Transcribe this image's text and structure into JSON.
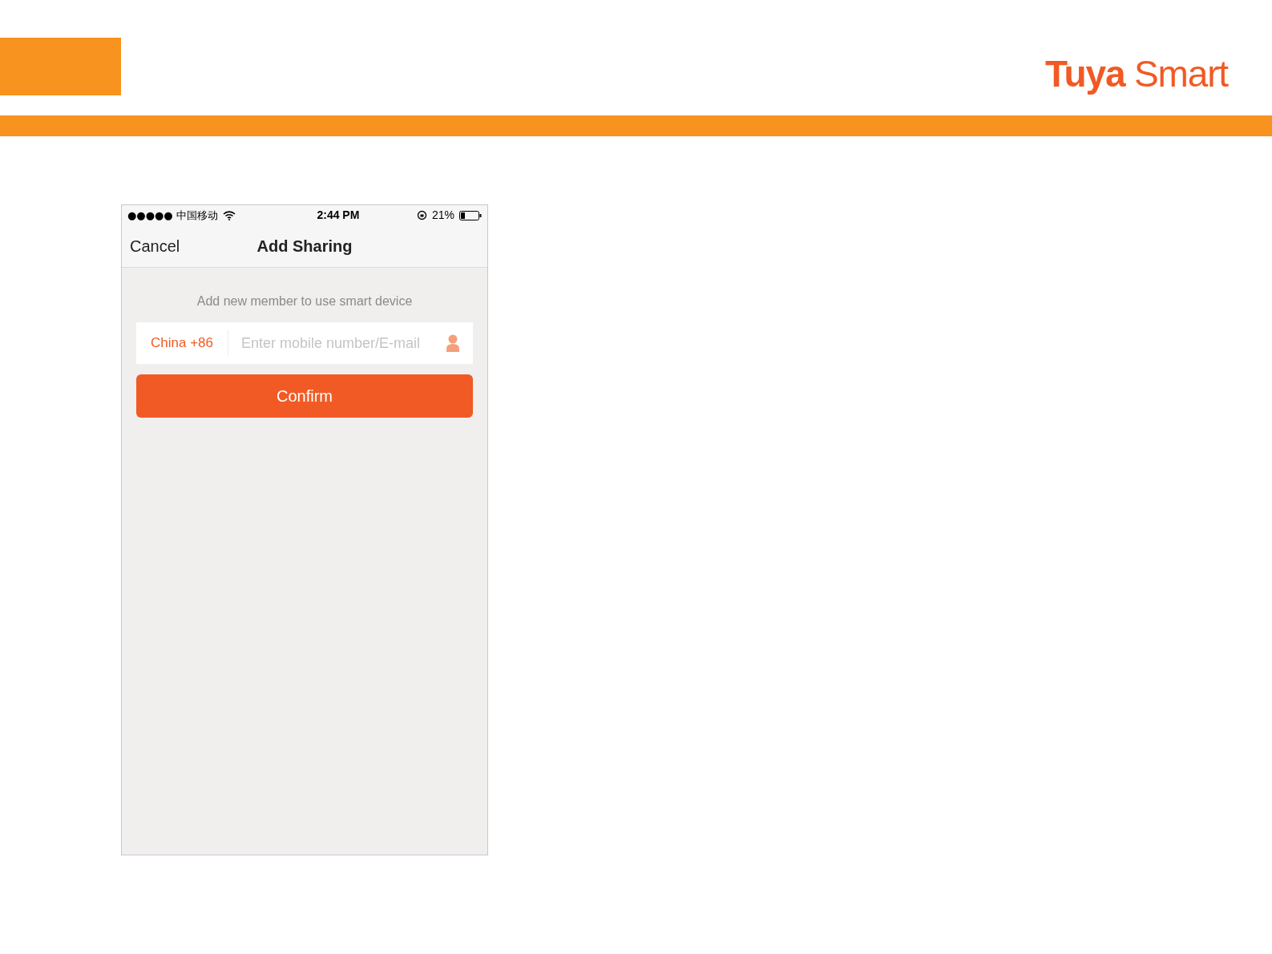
{
  "logo": "**Tuya** Smart",
  "status_bar": {
    "carrier": "●●●●● 中国移动",
    "time": "2:44 PM",
    "battery": "21%"
  },
  "nav": {
    "cancel": "Cancel",
    "title": "Add Sharing"
  },
  "subtitle": "Add new member to use smart device",
  "phone_field": {
    "country": "China +86",
    "placeholder": "Enter mobile number/E-mail"
  },
  "confirm_button": "Confirm"
}
